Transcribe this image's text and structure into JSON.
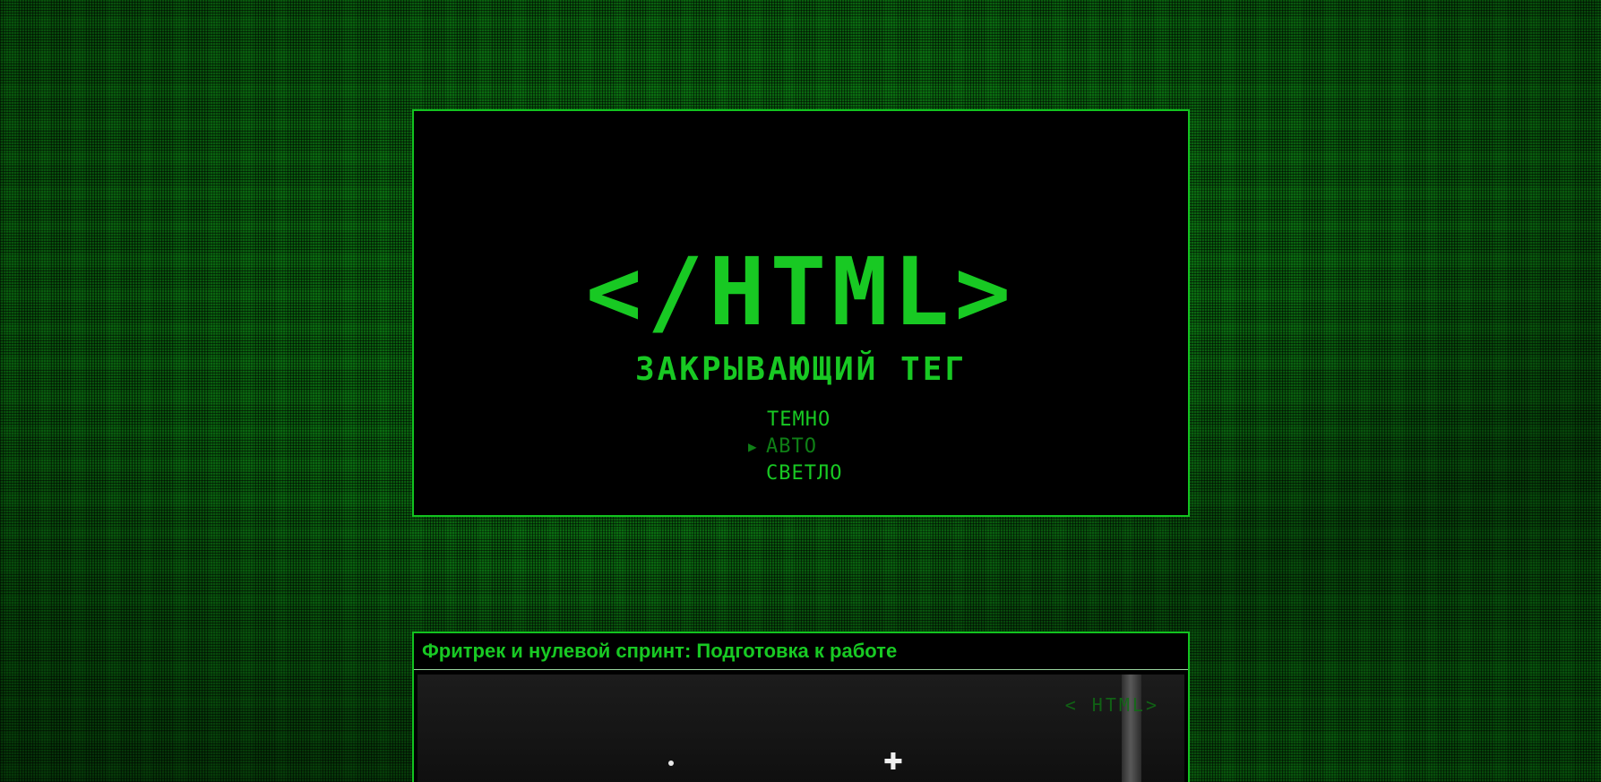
{
  "hero": {
    "logo": "</HTML>",
    "subtitle": "ЗАКРЫВАЮЩИЙ ТЕГ",
    "theme_menu": {
      "selected": "АВТО",
      "selected_marker": "▶",
      "items": [
        {
          "label": "ТЕМНО"
        },
        {
          "label": "АВТО"
        },
        {
          "label": "СВЕТЛО"
        }
      ]
    }
  },
  "post": {
    "title": "Фритрек и нулевой спринт: Подготовка к работе",
    "image_watermark": "< HTML>"
  },
  "colors": {
    "accent": "#18c923",
    "accent_dim": "#0f7f16",
    "panel": "#000000",
    "background": "#0a6a10"
  }
}
